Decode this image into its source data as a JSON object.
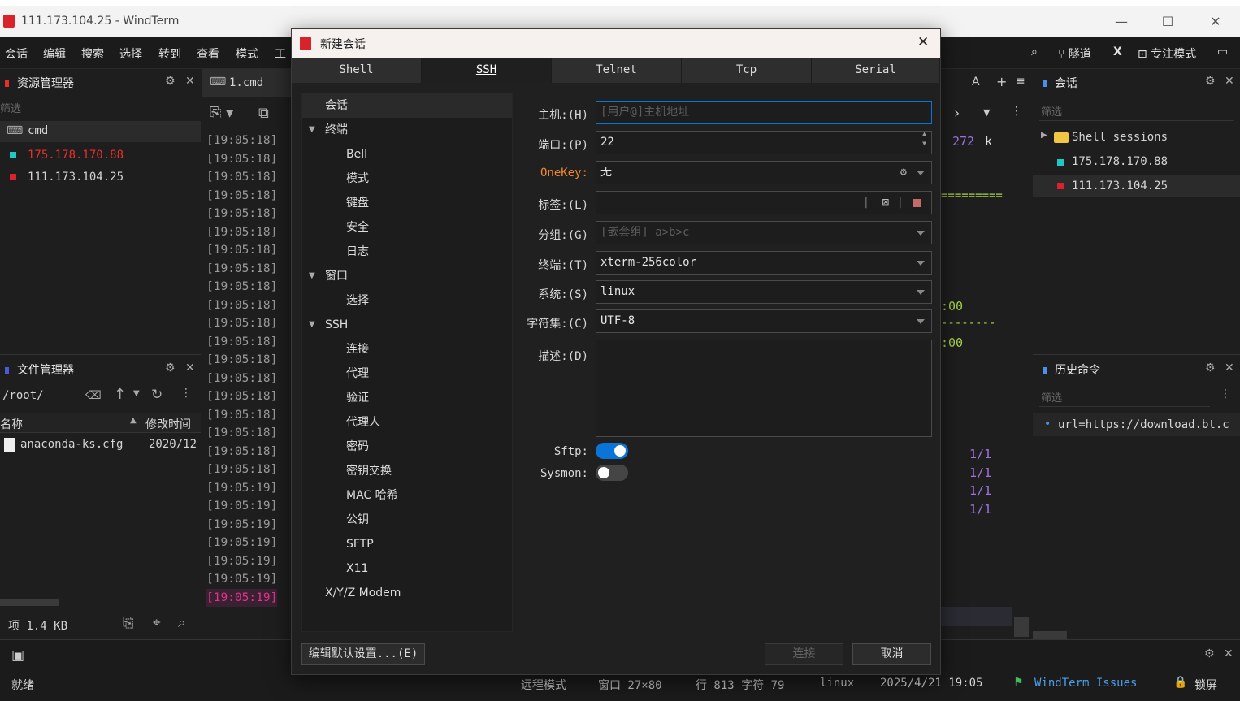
{
  "window": {
    "title": "111.173.104.25 - WindTerm"
  },
  "menu": [
    "会话",
    "编辑",
    "搜索",
    "选择",
    "转到",
    "查看",
    "模式",
    "工"
  ],
  "toolbar_right": {
    "tunnel": "隧道",
    "x": "X",
    "focus": "专注模式"
  },
  "explorer": {
    "title": "资源管理器",
    "filter": "筛选",
    "items": [
      {
        "label": "cmd",
        "color": "#d4d4d4"
      },
      {
        "label": "175.178.170.88",
        "color": "#e8302a"
      },
      {
        "label": "111.173.104.25",
        "color": "#d4d4d4"
      }
    ]
  },
  "files": {
    "title": "文件管理器",
    "path": "/root/",
    "col_name": "名称",
    "col_time": "修改时间",
    "rows": [
      {
        "name": "anaconda-ks.cfg",
        "time": "2020/12"
      }
    ],
    "footer": "项 1.4 KB"
  },
  "terminal": {
    "tab": "1.cmd",
    "timestamps": [
      "[19:05:18]",
      "[19:05:18]",
      "[19:05:18]",
      "[19:05:18]",
      "[19:05:18]",
      "[19:05:18]",
      "[19:05:18]",
      "[19:05:18]",
      "[19:05:18]",
      "[19:05:18]",
      "[19:05:18]",
      "[19:05:18]",
      "[19:05:18]",
      "[19:05:18]",
      "[19:05:18]",
      "[19:05:18]",
      "[19:05:18]",
      "[19:05:18]",
      "[19:05:18]",
      "[19:05:19]",
      "[19:05:19]",
      "[19:05:19]",
      "[19:05:19]",
      "[19:05:19]",
      "[19:05:19]",
      "[19:05:19]"
    ],
    "right_text": {
      "num": "272",
      "k": "k",
      "eq": "=========",
      "t1": ":00",
      "dash": "--------",
      "t2": ":00",
      "fracs": [
        "1/1",
        "1/1",
        "1/1",
        "1/1"
      ]
    }
  },
  "sessions": {
    "title": "会话",
    "filter": "筛选",
    "folder": "Shell sessions",
    "items": [
      "175.178.170.88",
      "111.173.104.25"
    ]
  },
  "history": {
    "title": "历史命令",
    "filter": "筛选",
    "items": [
      "url=https://download.bt.c"
    ]
  },
  "dialog": {
    "title": "新建会话",
    "tabs": [
      "Shell",
      "SSH",
      "Telnet",
      "Tcp",
      "Serial"
    ],
    "tree": [
      {
        "label": "会话",
        "lvl": 0
      },
      {
        "label": "终端",
        "lvl": 0,
        "exp": true
      },
      {
        "label": "Bell",
        "lvl": 1
      },
      {
        "label": "模式",
        "lvl": 1
      },
      {
        "label": "键盘",
        "lvl": 1
      },
      {
        "label": "安全",
        "lvl": 1
      },
      {
        "label": "日志",
        "lvl": 1
      },
      {
        "label": "窗口",
        "lvl": 0,
        "exp": true
      },
      {
        "label": "选择",
        "lvl": 1
      },
      {
        "label": "SSH",
        "lvl": 0,
        "exp": true
      },
      {
        "label": "连接",
        "lvl": 1
      },
      {
        "label": "代理",
        "lvl": 1
      },
      {
        "label": "验证",
        "lvl": 1
      },
      {
        "label": "代理人",
        "lvl": 1
      },
      {
        "label": "密码",
        "lvl": 1
      },
      {
        "label": "密钥交换",
        "lvl": 1
      },
      {
        "label": "MAC 哈希",
        "lvl": 1
      },
      {
        "label": "公钥",
        "lvl": 1
      },
      {
        "label": "SFTP",
        "lvl": 1
      },
      {
        "label": "X11",
        "lvl": 1
      },
      {
        "label": "X/Y/Z Modem",
        "lvl": 0
      }
    ],
    "host_label": "主机:(H)",
    "host_ph": "[用户@]主机地址",
    "port_label": "端口:(P)",
    "port": "22",
    "onekey_label": "OneKey:",
    "onekey": "无",
    "tag_label": "标签:(L)",
    "group_label": "分组:(G)",
    "group_ph": "[嵌套组] a>b>c",
    "term_label": "终端:(T)",
    "term": "xterm-256color",
    "sys_label": "系统:(S)",
    "sys": "linux",
    "charset_label": "字符集:(C)",
    "charset": "UTF-8",
    "desc_label": "描述:(D)",
    "sftp_label": "Sftp:",
    "sftp_on": true,
    "sysmon_label": "Sysmon:",
    "sysmon_on": false,
    "edit_default": "编辑默认设置...(E)",
    "connect": "连接",
    "cancel": "取消"
  },
  "status": {
    "ready": "就绪",
    "remote": "远程模式",
    "win": "窗口 27×80",
    "pos": "行 813 字符 79",
    "os": "linux",
    "datetime": "2025/4/21 19:05",
    "issues": "WindTerm Issues",
    "lock": "锁屏"
  },
  "colors": {
    "accent": "#0a74d8",
    "red": "#e8302a",
    "cyan": "#20c7c7",
    "green": "#a6d24a",
    "purple": "#a070e0"
  }
}
